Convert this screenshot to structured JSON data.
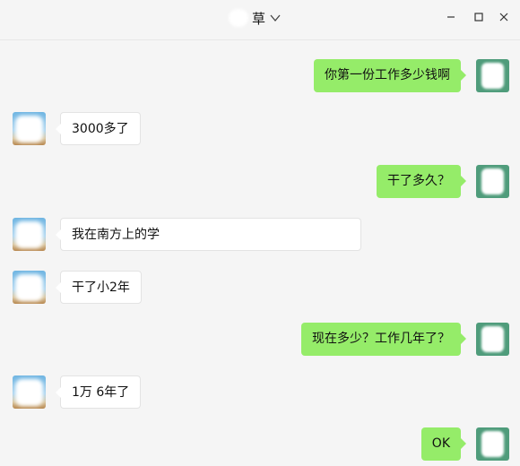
{
  "window": {
    "title": "草",
    "icons": [
      "chevron-down-icon",
      "minimize-icon",
      "maximize-icon",
      "close-icon"
    ]
  },
  "messages": [
    {
      "side": "self",
      "text": "你第一份工作多少钱啊"
    },
    {
      "side": "other",
      "text": "3000多了"
    },
    {
      "side": "self",
      "text": "干了多久？"
    },
    {
      "side": "other",
      "text": "我在南方上的学"
    },
    {
      "side": "other",
      "text": "干了小2年"
    },
    {
      "side": "self",
      "text": "现在多少？工作几年了？"
    },
    {
      "side": "other",
      "text": "1万 6年了"
    },
    {
      "side": "self",
      "text": "OK"
    }
  ],
  "colors": {
    "self_bubble": "#95ec69",
    "other_bubble": "#ffffff",
    "background": "#f5f5f5",
    "self_avatar": "#4f9c7b"
  }
}
